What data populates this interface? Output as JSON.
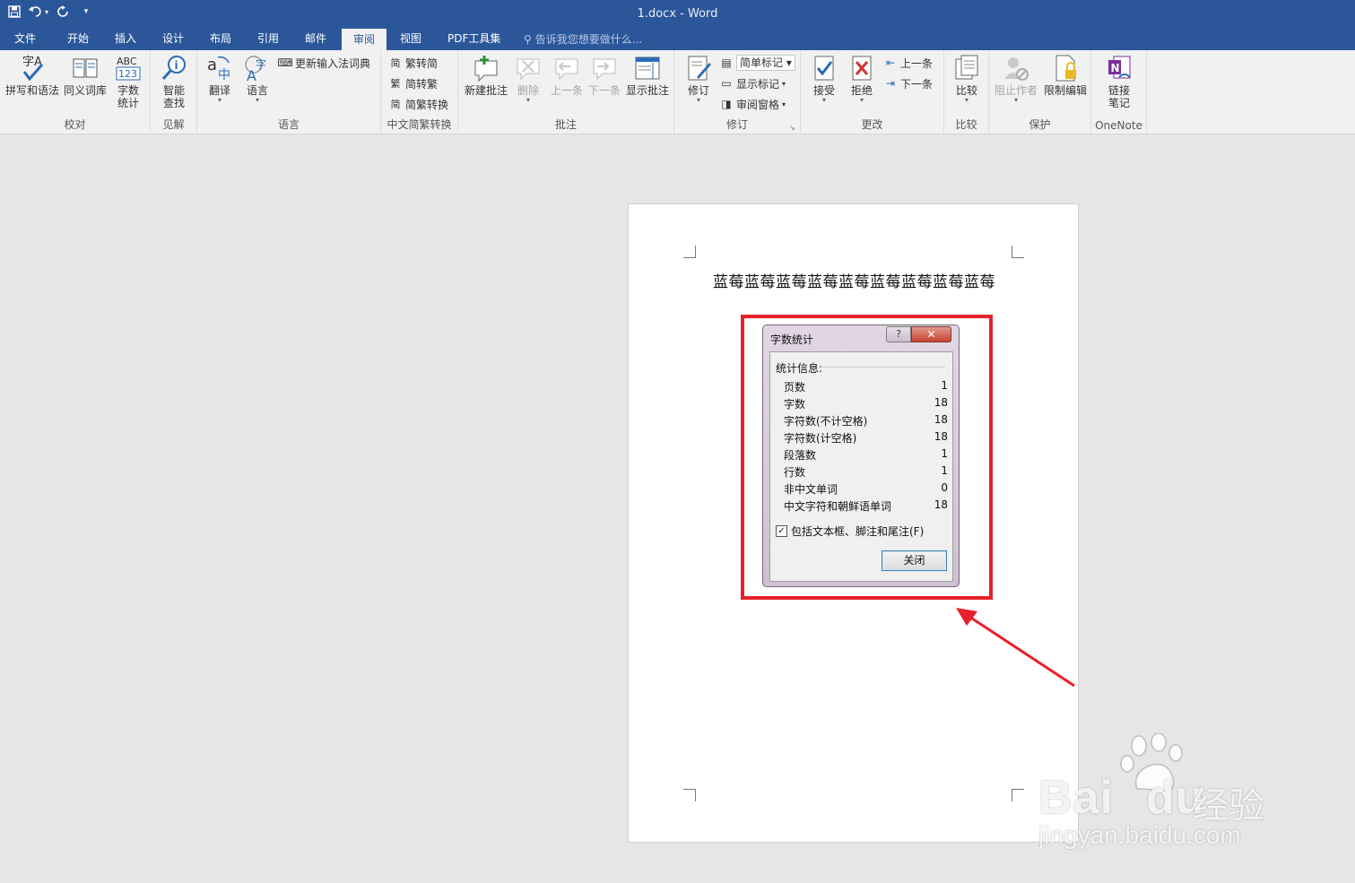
{
  "titlebar": {
    "title": "1.docx - Word",
    "qat": {
      "save_icon": "save-icon",
      "undo_icon": "undo-icon",
      "redo_icon": "redo-icon",
      "customize_icon": "customize-qat-icon"
    }
  },
  "tabs": [
    {
      "label": "文件"
    },
    {
      "label": "开始"
    },
    {
      "label": "插入"
    },
    {
      "label": "设计"
    },
    {
      "label": "布局"
    },
    {
      "label": "引用"
    },
    {
      "label": "邮件"
    },
    {
      "label": "审阅",
      "active": true
    },
    {
      "label": "视图"
    },
    {
      "label": "PDF工具集"
    }
  ],
  "tellme": {
    "placeholder": "告诉我您想要做什么..."
  },
  "ribbon": {
    "proofing": {
      "label": "校对",
      "spelling": "拼写和语法",
      "thesaurus": "同义词库",
      "wordcount_line1": "字数",
      "wordcount_line2": "统计"
    },
    "insights": {
      "label": "见解",
      "smart_line1": "智能",
      "smart_line2": "查找"
    },
    "language": {
      "label": "语言",
      "translate": "翻译",
      "language": "语言",
      "update_ime": "更新输入法词典"
    },
    "chinese_conversion": {
      "label": "中文简繁转换",
      "to_simplified": "繁转简",
      "to_traditional": "简转繁",
      "conversion": "简繁转换"
    },
    "comments": {
      "label": "批注",
      "new": "新建批注",
      "delete": "删除",
      "previous": "上一条",
      "next": "下一条",
      "show": "显示批注"
    },
    "tracking": {
      "label": "修订",
      "track": "修订",
      "simple_markup": "简单标记",
      "show_markup": "显示标记",
      "review_pane": "审阅窗格"
    },
    "changes": {
      "label": "更改",
      "accept": "接受",
      "reject": "拒绝",
      "previous": "上一条",
      "next": "下一条"
    },
    "compare": {
      "label": "比较",
      "compare": "比较"
    },
    "protect": {
      "label": "保护",
      "block_authors": "阻止作者",
      "restrict_editing": "限制编辑"
    },
    "onenote": {
      "label": "OneNote",
      "linked_line1": "链接",
      "linked_line2": "笔记"
    }
  },
  "document": {
    "text": "蓝莓蓝莓蓝莓蓝莓蓝莓蓝莓蓝莓蓝莓蓝莓"
  },
  "dialog": {
    "title": "字数统计",
    "help": "?",
    "close_x": "✕",
    "stats_heading": "统计信息:",
    "rows": [
      {
        "label": "页数",
        "value": "1"
      },
      {
        "label": "字数",
        "value": "18"
      },
      {
        "label": "字符数(不计空格)",
        "value": "18"
      },
      {
        "label": "字符数(计空格)",
        "value": "18"
      },
      {
        "label": "段落数",
        "value": "1"
      },
      {
        "label": "行数",
        "value": "1"
      },
      {
        "label": "非中文单词",
        "value": "0"
      },
      {
        "label": "中文字符和朝鲜语单词",
        "value": "18"
      }
    ],
    "include_label": "包括文本框、脚注和尾注(F)",
    "include_checked": true,
    "close_button": "关闭"
  },
  "watermark": {
    "brand": "Bai",
    "brand2": "du",
    "suffix": "经验",
    "url": "jingyan.baidu.com"
  },
  "colors": {
    "accent": "#2b579a",
    "highlight": "#e8202a"
  }
}
